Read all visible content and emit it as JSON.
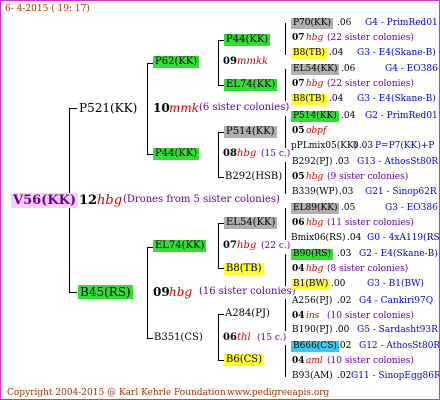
{
  "header": {
    "timestamp": "6- 4-2015 ( 19: 17)"
  },
  "footer": {
    "copyright": "Copyright 2004-2015 @ Karl Kehrle Foundation.",
    "url": "www.pedigreeapis.org"
  },
  "root": {
    "id": "V56(KK)",
    "year": "12",
    "breeder": "hbg",
    "note": "(Drones from 5 sister colonies)"
  },
  "gen1": {
    "sire": {
      "id": "P521(KK)",
      "year": "10",
      "breeder": "mmk",
      "note": "(6 sister colonies)"
    },
    "dam": {
      "id": "B45(RS)",
      "year": "09",
      "breeder": "hbg",
      "note": "(16 sister colonies)"
    }
  },
  "gen2": {
    "a": {
      "id": "P62(KK)",
      "year": "09",
      "breeder": "mmkk"
    },
    "b": {
      "id": "P44(KK)",
      "year": "08",
      "breeder": "hbg",
      "note": "(15 c.)"
    },
    "c": {
      "id": "EL74(KK)",
      "year": "07",
      "breeder": "hbg",
      "note": "(22 c.)"
    },
    "d": {
      "id": "B351(CS)",
      "year": "06",
      "breeder": "thl",
      "note": "(15 c.)"
    }
  },
  "gen3": {
    "a1": "P44(KK)",
    "a2": "EL74(KK)",
    "b1": "P514(KK)",
    "b2": "B292(HSB)",
    "c1": "EL54(KK)",
    "c2": "B8(TB)",
    "d1": "A284(PJ)",
    "d2": "B6(CS)"
  },
  "gen4": [
    {
      "id": "P70(KK)",
      "num": ".06",
      "info": "G4 - PrimRed01"
    },
    {
      "year": "07",
      "breeder": "hbg",
      "info": "(22 sister colonies)"
    },
    {
      "id": "B8(TB)",
      "num": ".04",
      "info": "G3 - E4(Skane-B)"
    },
    {
      "id": "EL54(KK)",
      "num": ".06",
      "info": "G4 - EO386"
    },
    {
      "year": "07",
      "breeder": "hbg",
      "info": "(22 sister colonies)"
    },
    {
      "id": "B8(TB)",
      "num": ".04",
      "info": "G3 - E4(Skane-B)"
    },
    {
      "id": "P514(KK)",
      "num": ".04",
      "info": "G2 - PrimRed01"
    },
    {
      "year": "05",
      "breeder": "obpf",
      "info": ""
    },
    {
      "id": "pPLmix05(KK)",
      "num": "0.03",
      "info": "P=P7(KK)+P"
    },
    {
      "id": "B292(PJ)",
      "num": ".03",
      "info": "G13 - AthosSt80R"
    },
    {
      "year": "05",
      "breeder": "hbg",
      "info": "(9 sister colonies)"
    },
    {
      "id": "B339(WP)",
      "num": ".03",
      "info": "G21 - Sinop62R"
    },
    {
      "id": "EL89(KK)",
      "num": ".05",
      "info": "G3 - EO386"
    },
    {
      "year": "06",
      "breeder": "hbg",
      "info": "(11 sister colonies)"
    },
    {
      "id": "Bmix06(RS)",
      "num": ".04",
      "info": "G0 - 4xA119(RS)"
    },
    {
      "id": "B90(RS)",
      "num": ".03",
      "info": "G2 - E4(Skane-B)"
    },
    {
      "year": "04",
      "breeder": "hbg",
      "info": "(8 sister colonies)"
    },
    {
      "id": "B1(BW)",
      "num": ".00",
      "info": "G3 - B1(BW)"
    },
    {
      "id": "A256(PJ)",
      "num": ".02",
      "info": "G4 - Cankiri97Q"
    },
    {
      "year": "04",
      "breeder": "ins",
      "info": "(10 sister colonies)"
    },
    {
      "id": "B190(PJ)",
      "num": ".00",
      "info": "G5 - Sardasht93R"
    },
    {
      "id": "B666(CS)",
      "num": ".02",
      "info": "G12 - AthosSt80R"
    },
    {
      "year": "04",
      "breeder": "aml",
      "info": "(10 sister colonies)"
    },
    {
      "id": "B93(AM)",
      "num": ".02",
      "info": "G11 - SinopEgg86R"
    }
  ]
}
